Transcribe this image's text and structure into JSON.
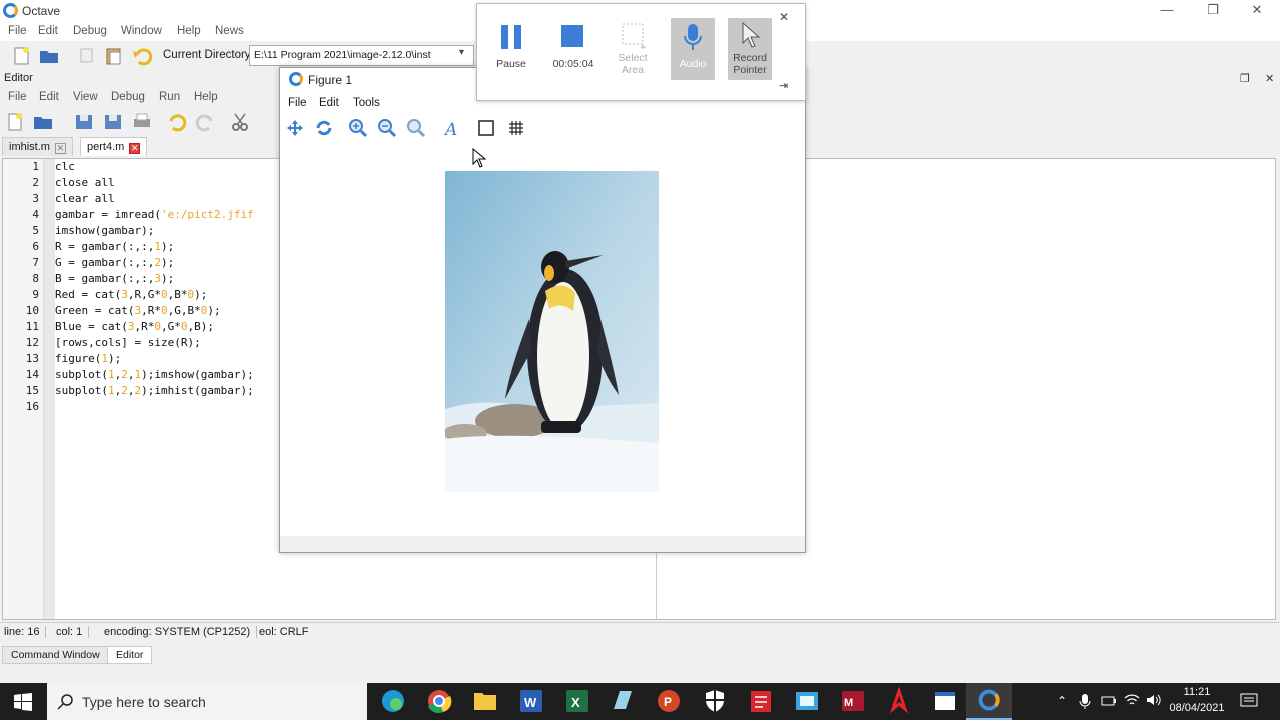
{
  "app": {
    "title": "Octave",
    "min_glyph": "—",
    "restore_glyph": "❐",
    "close_glyph": "✕"
  },
  "main_menu": [
    "File",
    "Edit",
    "Debug",
    "Window",
    "Help",
    "News"
  ],
  "toolbar": {
    "current_directory_label": "Current Directory:",
    "current_directory_value": "E:\\11 Program 2021\\image-2.12.0\\inst"
  },
  "editor": {
    "title": "Editor",
    "menu": [
      "File",
      "Edit",
      "View",
      "Debug",
      "Run",
      "Help"
    ],
    "tabs": [
      {
        "label": "imhist.m",
        "active": false
      },
      {
        "label": "pert4.m",
        "active": true
      }
    ],
    "line_numbers": [
      "1",
      "2",
      "3",
      "4",
      "5",
      "6",
      "7",
      "8",
      "9",
      "10",
      "11",
      "12",
      "13",
      "14",
      "15",
      "16"
    ],
    "code_lines": [
      "clc",
      "close all",
      "clear all",
      "gambar = imread('e:/pict2.jfif",
      "imshow(gambar);",
      "R = gambar(:,:,1);",
      "G = gambar(:,:,2);",
      "B = gambar(:,:,3);",
      "Red = cat(3,R,G*0,B*0);",
      "Green = cat(3,R*0,G,B*0);",
      "Blue = cat(3,R*0,G*0,B);",
      "[rows,cols] = size(R);",
      "figure(1);",
      "subplot(1,2,1);imshow(gambar);",
      "subplot(1,2,2);imhist(gambar);",
      ""
    ]
  },
  "status": {
    "line": "line: 16",
    "col": "col: 1",
    "encoding": "encoding: SYSTEM (CP1252)",
    "eol": "eol: CRLF"
  },
  "bottom_tabs": [
    {
      "label": "Command Window",
      "active": false
    },
    {
      "label": "Editor",
      "active": true
    }
  ],
  "figure": {
    "title": "Figure 1",
    "menu": [
      "File",
      "Edit",
      "Tools"
    ]
  },
  "recorder": {
    "pause_label": "Pause",
    "time": "00:05:04",
    "select_area_label1": "Select",
    "select_area_label2": "Area",
    "audio_label": "Audio",
    "record_pointer_label1": "Record",
    "record_pointer_label2": "Pointer",
    "close_glyph": "✕",
    "pin_glyph": "⇥"
  },
  "taskbar": {
    "search_placeholder": "Type here to search",
    "time": "11:21",
    "date": "08/04/2021"
  },
  "colors": {
    "accent_blue": "#2a7fd4",
    "octave_orange": "#f0a020",
    "taskbar": "#1e1e1e"
  }
}
